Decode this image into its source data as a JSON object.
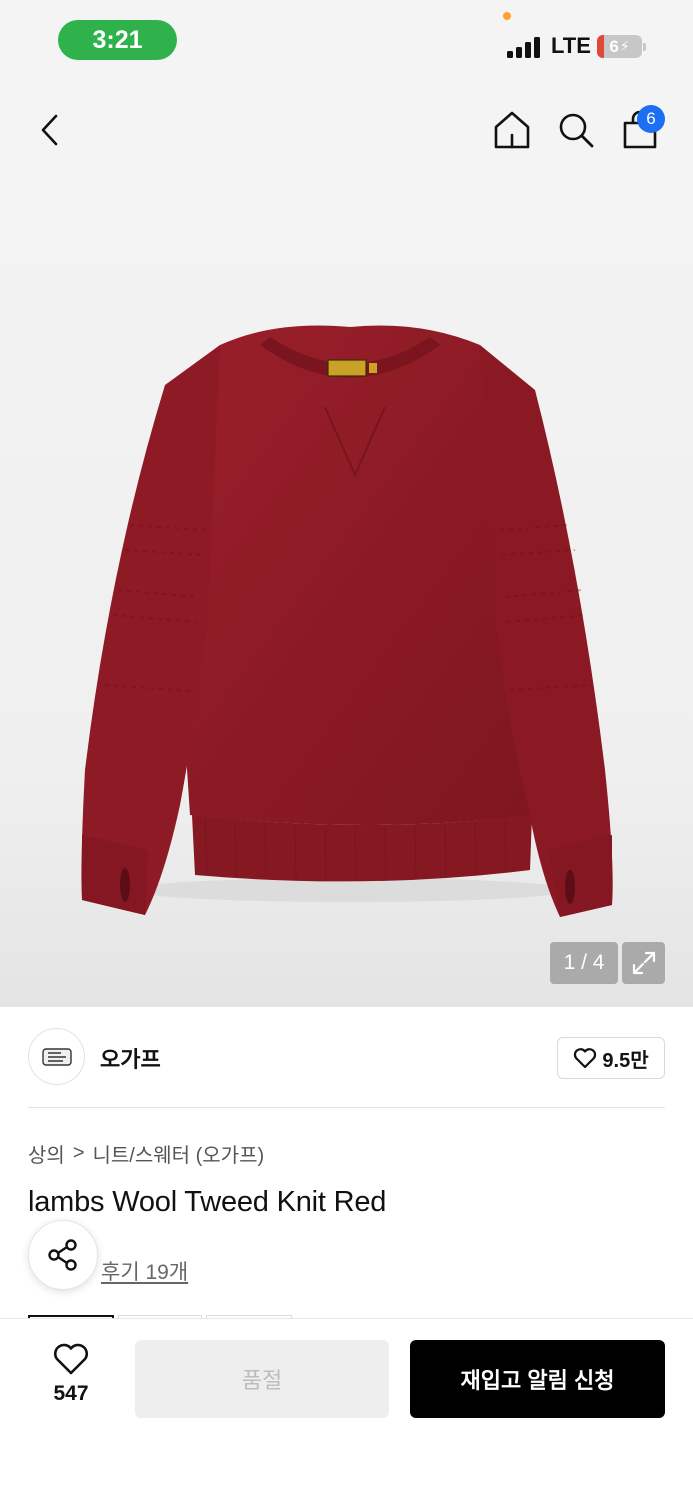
{
  "status_bar": {
    "time": "3:21",
    "network": "LTE",
    "battery": "6"
  },
  "nav": {
    "cart_count": "6"
  },
  "gallery": {
    "counter": "1 / 4"
  },
  "brand": {
    "name": "오가프",
    "likes": "9.5만"
  },
  "breadcrumb": {
    "category": "상의",
    "separator": ">",
    "subcategory": "니트/스웨터 (오가프)"
  },
  "product": {
    "title": "lambs Wool Tweed Knit Red",
    "review_link": "후기 19개"
  },
  "bottom_bar": {
    "like_count": "547",
    "soldout_label": "품절",
    "restock_label": "재입고 알림 신청"
  },
  "colors": {
    "accent_badge": "#1c6ef2",
    "time_pill": "#2fb24c",
    "sweater": "#8e1b24"
  }
}
